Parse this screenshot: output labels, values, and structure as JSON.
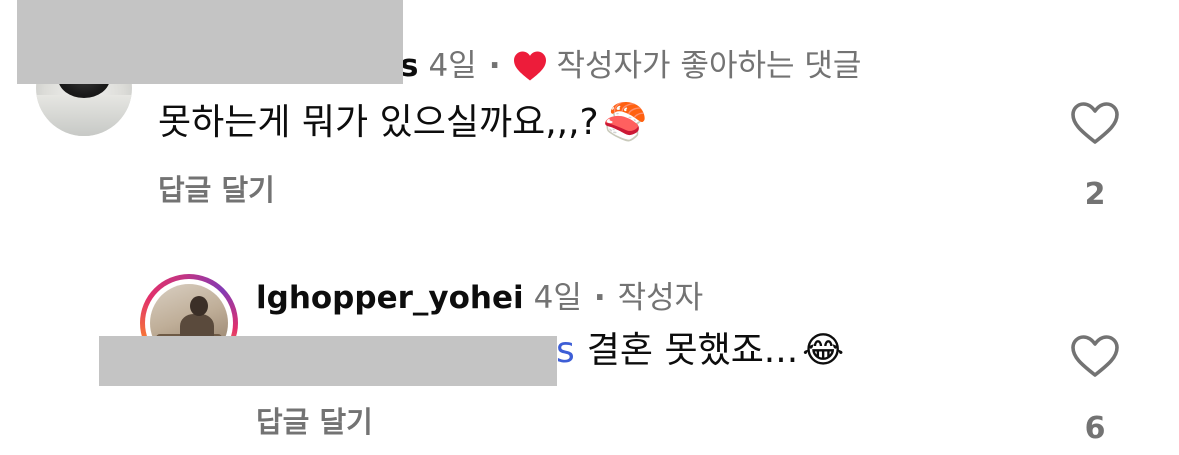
{
  "comments": [
    {
      "username_visible_tail": "s",
      "time": "4일",
      "separator": "·",
      "badge_text": "작성자가 좋아하는 댓글",
      "badge_icon": "red-heart-icon",
      "text": "못하는게 뭐가 있으실까요,,,?",
      "emoji": "🍣",
      "reply_label": "답글 달기",
      "like_count": "2"
    },
    {
      "username": "lghopper_yohei",
      "time": "4일",
      "separator": "·",
      "author_label": "작성자",
      "mention_visible_tail": "s",
      "text": "결혼 못했죠...",
      "emoji": "😂",
      "reply_label": "답글 달기",
      "like_count": "6"
    }
  ],
  "colors": {
    "meta_gray": "#737373",
    "mention_blue": "#3d5ed6",
    "badge_heart": "#ed1c3a",
    "redaction": "#c4c4c4",
    "story_ring": "#e1306c"
  }
}
